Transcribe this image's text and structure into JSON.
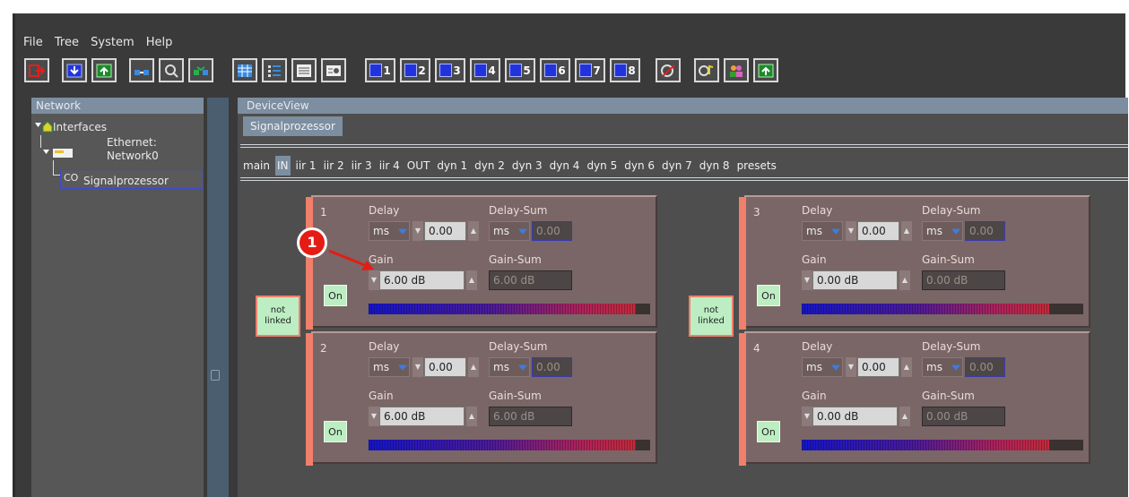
{
  "menu": [
    "File",
    "Tree",
    "System",
    "Help"
  ],
  "toolbar": {
    "numbered": [
      "1",
      "2",
      "3",
      "4",
      "5",
      "6",
      "7",
      "8"
    ]
  },
  "network": {
    "title": "Network",
    "interfaces": "Interfaces",
    "ethernet_line1": "Ethernet:",
    "ethernet_line2": "Network0",
    "device_prefix": "CO",
    "device": "Signalprozessor"
  },
  "deviceview": {
    "title": "DeviceView",
    "device_tab": "Signalprozessor",
    "tabs": [
      "main",
      "IN",
      "iir 1",
      "iir 2",
      "iir 3",
      "iir 4",
      "OUT",
      "dyn 1",
      "dyn 2",
      "dyn 3",
      "dyn 4",
      "dyn 5",
      "dyn 6",
      "dyn 7",
      "dyn 8",
      "presets"
    ],
    "active_tab": "IN"
  },
  "channels": [
    {
      "num": "1",
      "delay_label": "Delay",
      "delay_unit": "ms",
      "delay_value": "0.00",
      "delay_sum_label": "Delay-Sum",
      "delay_sum_unit": "ms",
      "delay_sum_value": "0.00",
      "gain_label": "Gain",
      "gain_value": "6.00 dB",
      "gain_sum_label": "Gain-Sum",
      "gain_sum_value": "6.00 dB",
      "on_label": "On",
      "meter_level": 0.95
    },
    {
      "num": "2",
      "delay_label": "Delay",
      "delay_unit": "ms",
      "delay_value": "0.00",
      "delay_sum_label": "Delay-Sum",
      "delay_sum_unit": "ms",
      "delay_sum_value": "0.00",
      "gain_label": "Gain",
      "gain_value": "6.00 dB",
      "gain_sum_label": "Gain-Sum",
      "gain_sum_value": "6.00 dB",
      "on_label": "On",
      "meter_level": 0.95
    },
    {
      "num": "3",
      "delay_label": "Delay",
      "delay_unit": "ms",
      "delay_value": "0.00",
      "delay_sum_label": "Delay-Sum",
      "delay_sum_unit": "ms",
      "delay_sum_value": "0.00",
      "gain_label": "Gain",
      "gain_value": "0.00 dB",
      "gain_sum_label": "Gain-Sum",
      "gain_sum_value": "0.00 dB",
      "on_label": "On",
      "meter_level": 0.88
    },
    {
      "num": "4",
      "delay_label": "Delay",
      "delay_unit": "ms",
      "delay_value": "0.00",
      "delay_sum_label": "Delay-Sum",
      "delay_sum_unit": "ms",
      "delay_sum_value": "0.00",
      "gain_label": "Gain",
      "gain_value": "0.00 dB",
      "gain_sum_label": "Gain-Sum",
      "gain_sum_value": "0.00 dB",
      "on_label": "On",
      "meter_level": 0.88
    }
  ],
  "link_buttons": [
    {
      "line1": "not",
      "line2": "linked"
    },
    {
      "line1": "not",
      "line2": "linked"
    }
  ],
  "callout": "1",
  "colors": {
    "callout": "#e41c14",
    "panel_bar": "#f07f6b",
    "on_button": "#bdeec3",
    "title_bar": "#7d8ea0"
  }
}
